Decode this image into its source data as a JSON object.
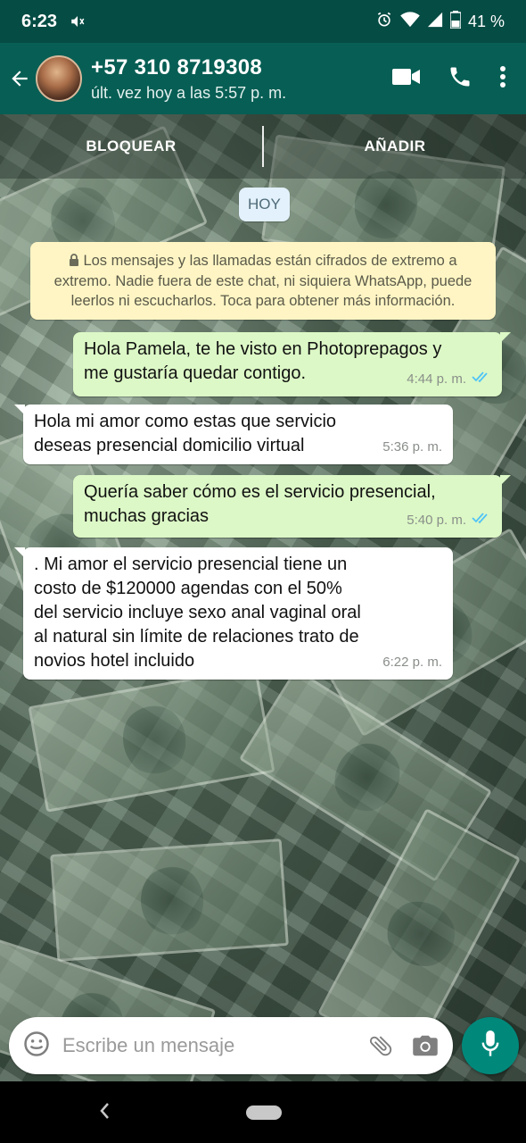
{
  "status_bar": {
    "time": "6:23",
    "battery": "41 %",
    "icons": [
      "volume-off-icon",
      "alarm-icon",
      "wifi-icon",
      "signal-icon",
      "battery-icon"
    ]
  },
  "header": {
    "contact": "+57 310 8719308",
    "last_seen": "últ. vez hoy a las 5:57 p. m.",
    "icons": [
      "back-arrow-icon",
      "video-call-icon",
      "phone-icon",
      "more-vert-icon"
    ]
  },
  "block_bar": {
    "block": "BLOQUEAR",
    "add": "AÑADIR"
  },
  "date_chip": "HOY",
  "encryption_notice": "Los mensajes y las llamadas están cifrados de extremo a extremo. Nadie fuera de este chat, ni siquiera WhatsApp, puede leerlos ni escucharlos. Toca para obtener más información.",
  "messages": [
    {
      "direction": "out",
      "lines": [
        "Hola Pamela, te he visto en Photoprepagos y",
        "me gustaría quedar contigo."
      ],
      "time": "4:44 p. m.",
      "read": true
    },
    {
      "direction": "in",
      "lines": [
        "Hola mi amor como estas que servicio",
        "deseas presencial domicilio virtual"
      ],
      "time": "5:36 p. m."
    },
    {
      "direction": "out",
      "lines": [
        "Quería saber cómo es el servicio presencial,",
        "muchas gracias"
      ],
      "time": "5:40 p. m.",
      "read": true
    },
    {
      "direction": "in",
      "lines": [
        ". Mi amor el servicio presencial tiene un",
        "costo de $120000 agendas con el 50%",
        "del servicio incluye sexo anal vaginal oral",
        "al natural sin límite de relaciones trato de",
        "novios hotel incluido"
      ],
      "time": "6:22 p. m."
    }
  ],
  "composer": {
    "placeholder": "Escribe un mensaje",
    "icons": [
      "emoji-icon",
      "attach-icon",
      "camera-icon",
      "mic-icon"
    ]
  },
  "colors": {
    "header": "#075e54",
    "status_bar": "#054c44",
    "outgoing_bubble": "#dcf8c6",
    "incoming_bubble": "#ffffff",
    "read_ticks": "#4fc3f7",
    "mic_button": "#00897b"
  }
}
